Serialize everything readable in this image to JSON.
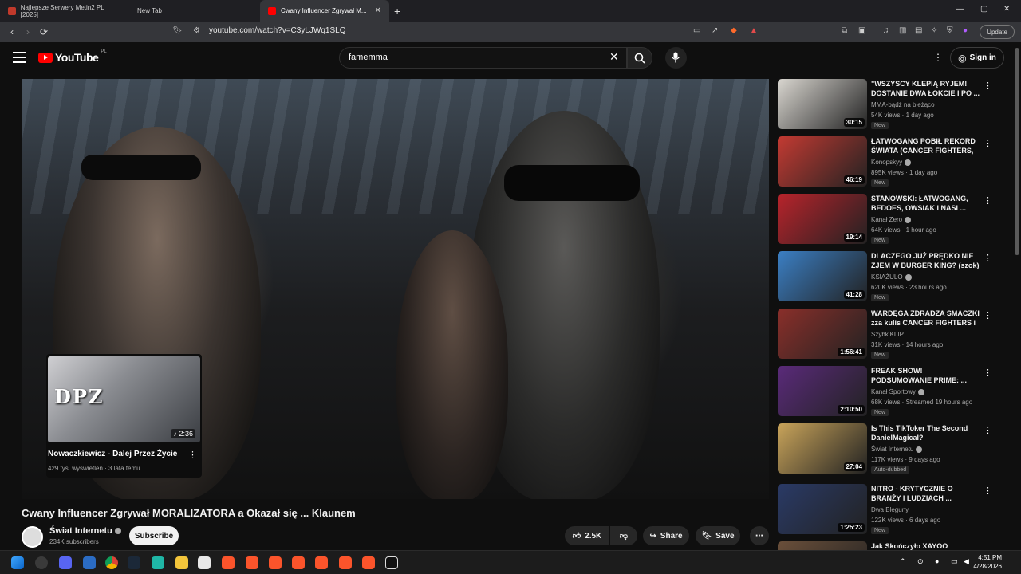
{
  "browser": {
    "tabs": [
      {
        "label": "Najlepsze Serwery Metin2 PL [2025]",
        "active": false
      },
      {
        "label": "New Tab",
        "active": false
      },
      {
        "label": "Cwany Influencer Zgrywał M...",
        "active": true
      }
    ],
    "url": "youtube.com/watch?v=C3yLJWq1SLQ",
    "update_label": "Update"
  },
  "masthead": {
    "logo_text": "YouTube",
    "country_code": "PL",
    "search_value": "famemma",
    "signin_label": "Sign in"
  },
  "endcard": {
    "thumb_text": "DPZ",
    "duration": "2:36",
    "title": "Nowaczkiewicz - Dalej Przez Życie",
    "meta": "429 tys. wyświetleń · 3 lata temu"
  },
  "video": {
    "title": "Cwany Influencer Zgrywał MORALIZATORA a Okazał się ... Klaunem",
    "channel": "Świat Internetu",
    "subscribers": "234K subscribers",
    "subscribe_label": "Subscribe",
    "likes": "2.5K",
    "share_label": "Share",
    "save_label": "Save"
  },
  "recommendations": [
    {
      "title": "\"WSZYSCY KLEPIĄ RYJEM! DOSTANIE DWA ŁOKCIE I PO ...",
      "channel": "MMA-bądź na bieżąco",
      "verified": false,
      "meta": "54K views · 1 day ago",
      "badge": "New",
      "duration": "30:15",
      "thumb_color": "#d9d6d0"
    },
    {
      "title": "ŁATWOGANG POBIŁ REKORD ŚWIATA (CANCER FIGHTERS, ...",
      "channel": "Konopskyy",
      "verified": true,
      "meta": "895K views · 1 day ago",
      "badge": "New",
      "duration": "46:19",
      "thumb_color": "#c33a32"
    },
    {
      "title": "STANOWSKI: ŁATWOGANG, BEDOES, OWSIAK I NASI ...",
      "channel": "Kanał Zero",
      "verified": true,
      "meta": "64K views · 1 hour ago",
      "badge": "New",
      "duration": "19:14",
      "thumb_color": "#b8232b"
    },
    {
      "title": "DLACZEGO JUŻ PRĘDKO NIE ZJEM W BURGER KING? (szok)",
      "channel": "KSIĄŻULO",
      "verified": true,
      "meta": "620K views · 23 hours ago",
      "badge": "New",
      "duration": "41:28",
      "thumb_color": "#3b7fc4"
    },
    {
      "title": "WARDĘGA ZDRADZA SMACZKI zza kulis CANCER FIGHTERS i ...",
      "channel": "SzybkiKLIP",
      "verified": false,
      "meta": "31K views · 14 hours ago",
      "badge": "New",
      "duration": "1:56:41",
      "thumb_color": "#8a2f2a"
    },
    {
      "title": "FREAK SHOW! PODSUMOWANIE PRIME: ...",
      "channel": "Kanał Sportowy",
      "verified": true,
      "meta": "68K views · Streamed 19 hours ago",
      "badge": "New",
      "duration": "2:10:50",
      "thumb_color": "#5a2a7a"
    },
    {
      "title": "Is This TikToker The Second DanielMagical?",
      "channel": "Świat Internetu",
      "verified": true,
      "meta": "117K views · 9 days ago",
      "badge": "Auto-dubbed",
      "duration": "27:04",
      "thumb_color": "#c9a45a"
    },
    {
      "title": "NITRO - KRYTYCZNIE O BRANŻY I LUDZIACH ...",
      "channel": "Dwa Bleguny",
      "verified": false,
      "meta": "122K views · 6 days ago",
      "badge": "New",
      "duration": "1:25:23",
      "thumb_color": "#2a3a66"
    },
    {
      "title": "Jak Skończyło XAYOO",
      "channel": "",
      "verified": false,
      "meta": "",
      "badge": "",
      "duration": "",
      "thumb_color": "#6a4f3a"
    }
  ],
  "taskbar": {
    "time": "4:51 PM",
    "date": "4/28/2026"
  },
  "colors": {
    "accent": "#ff0000",
    "background": "#0f0f0f"
  }
}
